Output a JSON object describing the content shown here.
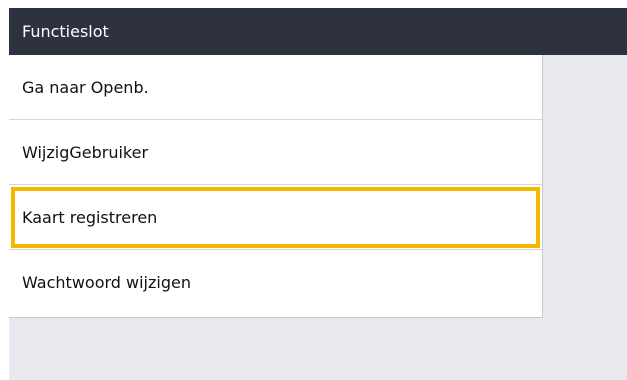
{
  "header": {
    "title": "Functieslot"
  },
  "menu": {
    "items": [
      {
        "label": "Ga naar Openb."
      },
      {
        "label": "WijzigGebruiker"
      },
      {
        "label": "Kaart registreren",
        "selected": true
      },
      {
        "label": "Wachtwoord wijzigen"
      }
    ]
  },
  "colors": {
    "header_bg": "#2e3140",
    "highlight": "#f5b800",
    "screen_bg": "#e8e9ee"
  }
}
